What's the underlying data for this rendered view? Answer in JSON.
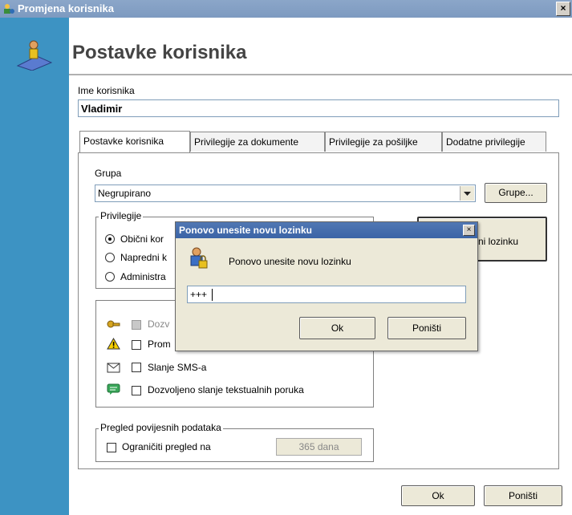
{
  "window": {
    "title": "Promjena korisnika",
    "close_glyph": "×",
    "header": "Postavke korisnika",
    "app_icon": "user-settings-icon",
    "sidebar_icon": "user-pen-icon"
  },
  "username": {
    "label": "Ime korisnika",
    "value": "Vladimir"
  },
  "tabs": [
    {
      "label": "Postavke korisnika",
      "active": true
    },
    {
      "label": "Privilegije za dokumente",
      "active": false
    },
    {
      "label": "Privilegije za pošiljke",
      "active": false
    },
    {
      "label": "Dodatne privilegije",
      "active": false
    }
  ],
  "group": {
    "label": "Grupa",
    "selected": "Negrupirano",
    "groups_button": "Grupe..."
  },
  "privileges": {
    "title": "Privilegije",
    "options": [
      {
        "label": "Obični kor",
        "selected": true
      },
      {
        "label": "Napredni k",
        "selected": false
      },
      {
        "label": "Administra",
        "selected": false
      }
    ]
  },
  "password_button_partial": "ni lozinku",
  "permissions": [
    {
      "icon": "key-icon",
      "label": "Dozv",
      "checked": false,
      "disabled": true
    },
    {
      "icon": "warning-icon",
      "label": "Prom",
      "checked": false,
      "disabled": false
    },
    {
      "icon": "envelope-icon",
      "label": "Slanje SMS-a",
      "checked": false,
      "disabled": false
    },
    {
      "icon": "chat-icon",
      "label": "Dozvoljeno slanje tekstualnih poruka",
      "checked": false,
      "disabled": false
    }
  ],
  "history": {
    "title": "Pregled povijesnih podataka",
    "checkbox_label": "Ograničiti pregled na",
    "days_value": "365 dana"
  },
  "footer": {
    "ok": "Ok",
    "cancel": "Poništi"
  },
  "dialog": {
    "title": "Ponovo unesite novu lozinku",
    "close_glyph": "×",
    "message": "Ponovo unesite novu lozinku",
    "input_value": "+++",
    "ok": "Ok",
    "cancel": "Poništi",
    "icon": "user-lock-icon"
  },
  "colors": {
    "sidebar": "#3d93c3",
    "titlebar": "#7d9ac0",
    "dialog_titlebar": "#3b64a6"
  }
}
